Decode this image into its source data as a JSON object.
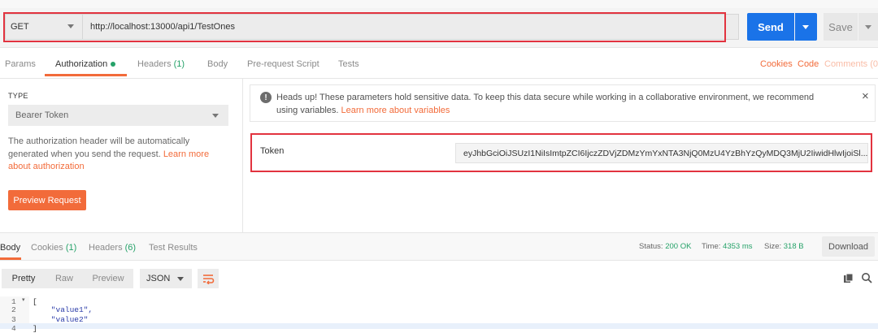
{
  "request": {
    "method": "GET",
    "url": "http://localhost:13000/api1/TestOnes",
    "send_label": "Send",
    "save_label": "Save"
  },
  "tabs": [
    {
      "label": "Params"
    },
    {
      "label": "Authorization"
    },
    {
      "label": "Headers",
      "count": "(1)"
    },
    {
      "label": "Body"
    },
    {
      "label": "Pre-request Script"
    },
    {
      "label": "Tests"
    }
  ],
  "right_links": {
    "cookies": "Cookies",
    "code": "Code",
    "comments": "Comments (0)"
  },
  "auth": {
    "type_label": "TYPE",
    "type_value": "Bearer Token",
    "help_text": "The authorization header will be automatically generated when you send the request.",
    "help_link": "Learn more about authorization",
    "preview_label": "Preview Request"
  },
  "notice": {
    "text": "Heads up! These parameters hold sensitive data. To keep this data secure while working in a collaborative environment, we recommend using variables.",
    "link": "Learn more about variables",
    "close": "×"
  },
  "token": {
    "label": "Token",
    "value": "eyJhbGciOiJSUzI1NiIsImtpZCI6IjczZDVjZDMzYmYxNTA3NjQ0MzU4YzBhYzQyMDQ3MjU2IiwidHlwIjoiSl..."
  },
  "response": {
    "tabs": [
      {
        "label": "Body"
      },
      {
        "label": "Cookies",
        "count": "(1)"
      },
      {
        "label": "Headers",
        "count": "(6)"
      },
      {
        "label": "Test Results"
      }
    ],
    "status_label": "Status:",
    "status_value": "200 OK",
    "time_label": "Time:",
    "time_value": "4353 ms",
    "size_label": "Size:",
    "size_value": "318 B",
    "download_label": "Download",
    "view_modes": [
      "Pretty",
      "Raw",
      "Preview"
    ],
    "format": "JSON",
    "lines": [
      {
        "n": "1",
        "text": "["
      },
      {
        "n": "2",
        "text": "    \"value1\","
      },
      {
        "n": "3",
        "text": "    \"value2\""
      },
      {
        "n": "4",
        "text": "]"
      }
    ]
  },
  "colors": {
    "accent": "#f26b3a",
    "primary": "#1a73e8",
    "success": "#26a269",
    "highlight": "#e2333f"
  }
}
